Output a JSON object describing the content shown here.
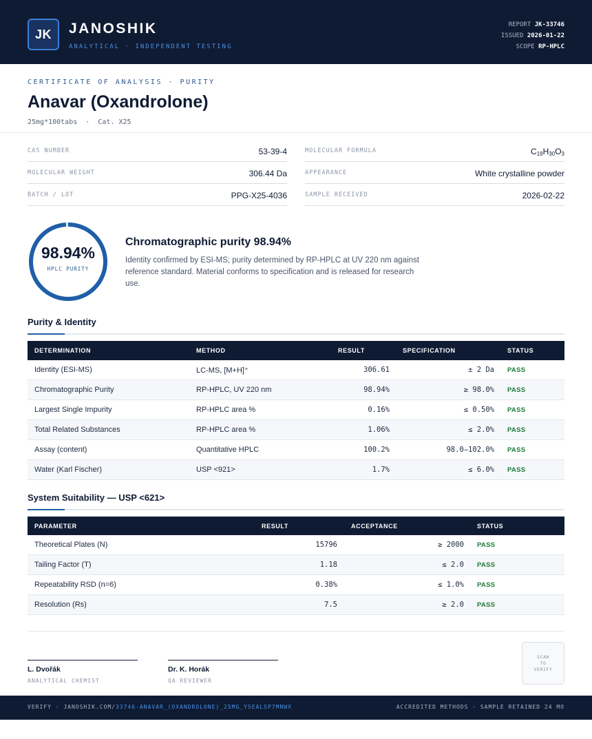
{
  "header": {
    "logo_text": "JK",
    "brand_name": "JANOSHIK",
    "brand_tagline": "ANALYTICAL · INDEPENDENT TESTING",
    "report_label": "REPORT",
    "report_value": "JK-33746",
    "issued_label": "ISSUED",
    "issued_value": "2026-01-22",
    "scope_label": "SCOPE",
    "scope_value": "RP-HPLC"
  },
  "title": {
    "cert_label": "CERTIFICATE OF ANALYSIS · PURITY",
    "product_name": "Anavar (Oxandrolone)",
    "product_sub": "25mg*100tabs  ·  Cat. X25"
  },
  "details": [
    {
      "label": "CAS NUMBER",
      "value": "53-39-4"
    },
    {
      "label": "MOLECULAR FORMULA",
      "value": "C19H30O3"
    },
    {
      "label": "MOLECULAR WEIGHT",
      "value": "306.44 Da"
    },
    {
      "label": "APPEARANCE",
      "value": "White crystalline powder"
    },
    {
      "label": "BATCH / LOT",
      "value": "PPG-X25-4036"
    },
    {
      "label": "SAMPLE RECEIVED",
      "value": "2026-02-22"
    }
  ],
  "purity": {
    "value_text": "98.94%",
    "fraction": 0.9894,
    "label": "HPLC PURITY",
    "summary_title": "Chromatographic purity 98.94%",
    "summary_text": "Identity confirmed by ESI-MS; purity determined by RP-HPLC at UV 220 nm against reference standard. Material conforms to specification and is released for research use."
  },
  "purity_identity": {
    "section_title": "Purity & Identity",
    "headers": {
      "determination": "DETERMINATION",
      "method": "METHOD",
      "result": "RESULT",
      "specification": "SPECIFICATION",
      "status": "STATUS"
    },
    "rows": [
      {
        "determination": "Identity (ESI-MS)",
        "method": "LC-MS, [M+H]⁺",
        "result": "306.61",
        "specification": "± 2 Da",
        "status": "PASS"
      },
      {
        "determination": "Chromatographic Purity",
        "method": "RP-HPLC, UV 220 nm",
        "result": "98.94%",
        "specification": "≥ 98.0%",
        "status": "PASS"
      },
      {
        "determination": "Largest Single Impurity",
        "method": "RP-HPLC area %",
        "result": "0.16%",
        "specification": "≤ 0.50%",
        "status": "PASS"
      },
      {
        "determination": "Total Related Substances",
        "method": "RP-HPLC area %",
        "result": "1.06%",
        "specification": "≤ 2.0%",
        "status": "PASS"
      },
      {
        "determination": "Assay (content)",
        "method": "Quantitative HPLC",
        "result": "100.2%",
        "specification": "98.0–102.0%",
        "status": "PASS"
      },
      {
        "determination": "Water (Karl Fischer)",
        "method": "USP <921>",
        "result": "1.7%",
        "specification": "≤ 6.0%",
        "status": "PASS"
      }
    ]
  },
  "system_suitability": {
    "section_title": "System Suitability — USP <621>",
    "headers": {
      "parameter": "PARAMETER",
      "result": "RESULT",
      "acceptance": "ACCEPTANCE",
      "status": "STATUS"
    },
    "rows": [
      {
        "parameter": "Theoretical Plates (N)",
        "result": "15796",
        "acceptance": "≥ 2000",
        "status": "PASS"
      },
      {
        "parameter": "Tailing Factor (T)",
        "result": "1.18",
        "acceptance": "≤ 2.0",
        "status": "PASS"
      },
      {
        "parameter": "Repeatability RSD (n=6)",
        "result": "0.38%",
        "acceptance": "≤ 1.0%",
        "status": "PASS"
      },
      {
        "parameter": "Resolution (Rs)",
        "result": "7.5",
        "acceptance": "≥ 2.0",
        "status": "PASS"
      }
    ]
  },
  "signatures": [
    {
      "name": "L. Dvořák",
      "role": "ANALYTICAL CHEMIST"
    },
    {
      "name": "Dr. K. Horák",
      "role": "QA REVIEWER"
    }
  ],
  "qr": {
    "line1": "SCAN",
    "line2": "TO",
    "line3": "VERIFY"
  },
  "footer": {
    "verify_prefix": "VERIFY · JANOSHIK.COM/",
    "verify_link": "33746-ANAVAR_(OXANDROLONE)_25MG_YSEALSP7MNWX",
    "right_text": "ACCREDITED METHODS · SAMPLE RETAINED 24 MO"
  },
  "colors": {
    "navy": "#0f1b33",
    "accent_blue": "#1f5fa8",
    "pass_green": "#1f7a3a"
  }
}
